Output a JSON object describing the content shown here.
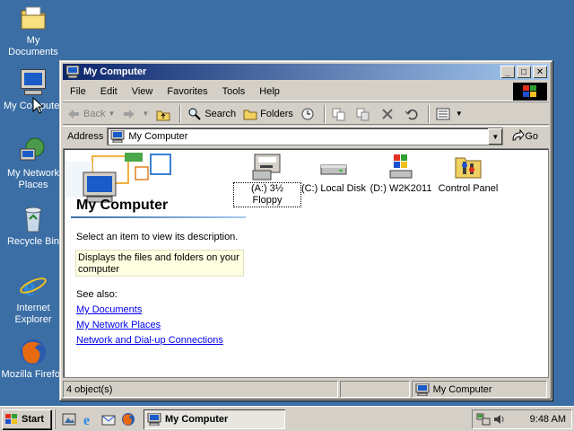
{
  "desktop": {
    "icons": [
      {
        "label": "My Documents",
        "icon": "folder-documents-icon"
      },
      {
        "label": "My Computer",
        "icon": "computer-icon"
      },
      {
        "label": "My Network Places",
        "icon": "network-icon"
      },
      {
        "label": "Recycle Bin",
        "icon": "recycle-bin-icon"
      },
      {
        "label": "Internet Explorer",
        "icon": "ie-icon"
      },
      {
        "label": "Mozilla Firefox",
        "icon": "firefox-icon"
      }
    ]
  },
  "window": {
    "title": "My Computer",
    "buttons": {
      "minimize": "_",
      "maximize": "□",
      "close": "✕"
    }
  },
  "menubar": {
    "items": [
      "File",
      "Edit",
      "View",
      "Favorites",
      "Tools",
      "Help"
    ]
  },
  "toolbar": {
    "back": "Back",
    "search": "Search",
    "folders": "Folders"
  },
  "address": {
    "label": "Address",
    "value": "My Computer",
    "go": "Go"
  },
  "left_pane": {
    "title": "My Computer",
    "description": "Select an item to view its description.",
    "hint": "Displays the files and folders on your computer",
    "see_also": "See also:",
    "links": [
      "My Documents",
      "My Network Places",
      "Network and Dial-up Connections"
    ]
  },
  "items": [
    {
      "label": "(A:) 3½ Floppy",
      "icon": "floppy-icon"
    },
    {
      "label": "(C:) Local Disk",
      "icon": "hard-disk-icon"
    },
    {
      "label": "(D:) W2K2011",
      "icon": "cd-drive-icon"
    },
    {
      "label": "Control Panel",
      "icon": "control-panel-icon"
    }
  ],
  "status": {
    "count": "4 object(s)",
    "location": "My Computer"
  },
  "taskbar": {
    "start": "Start",
    "task": "My Computer",
    "clock": "9:48 AM"
  },
  "colors": {
    "desktop": "#3a6ea5",
    "title_start": "#0a246a",
    "title_end": "#a6caf0",
    "face": "#d4d0c8",
    "link": "#0000ee"
  }
}
